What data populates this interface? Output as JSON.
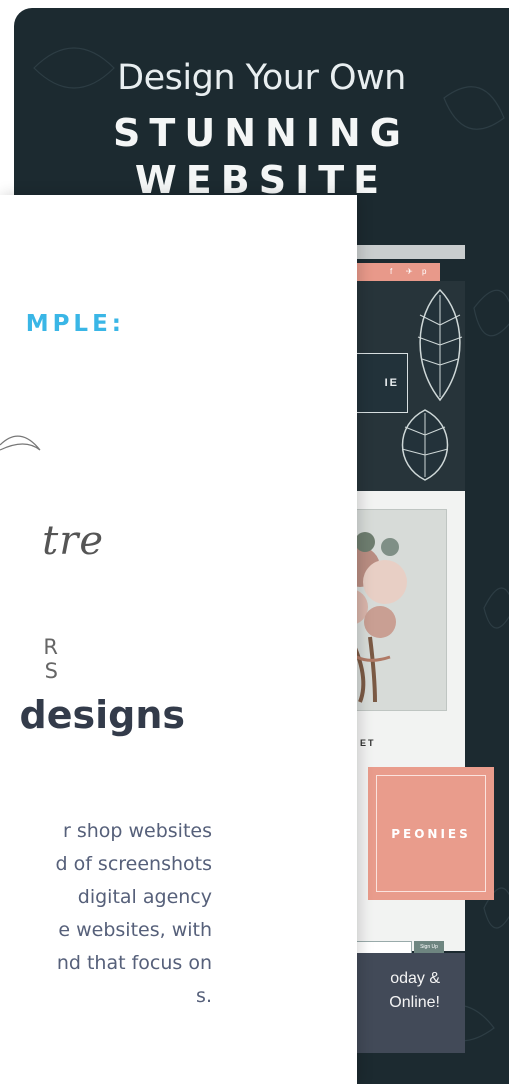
{
  "poster": {
    "title_line1": "Design Your Own",
    "title_line2": "STUNNING",
    "title_line3": "WEBSITE",
    "background_color": "#1c2a30",
    "mock_site": {
      "name_partial": "IE",
      "social_icons": [
        "f",
        "✈",
        "p"
      ],
      "section_label_partial": "ET",
      "signup_button": "Sign Up",
      "bottom_text_line1": "oday &",
      "bottom_text_line2": "Online!"
    },
    "peonies_label": "PEONIES",
    "peonies_color": "#e99c8c"
  },
  "card": {
    "example_label": "MPLE:",
    "script_word": "tre",
    "script_subtitle": "R S",
    "heading": "designs",
    "paragraph_lines": [
      "r shop websites",
      "d of screenshots",
      "digital agency",
      "e websites, with",
      "nd that focus on",
      "s."
    ],
    "accent_color": "#3ab6e6",
    "heading_color": "#333b4a"
  }
}
